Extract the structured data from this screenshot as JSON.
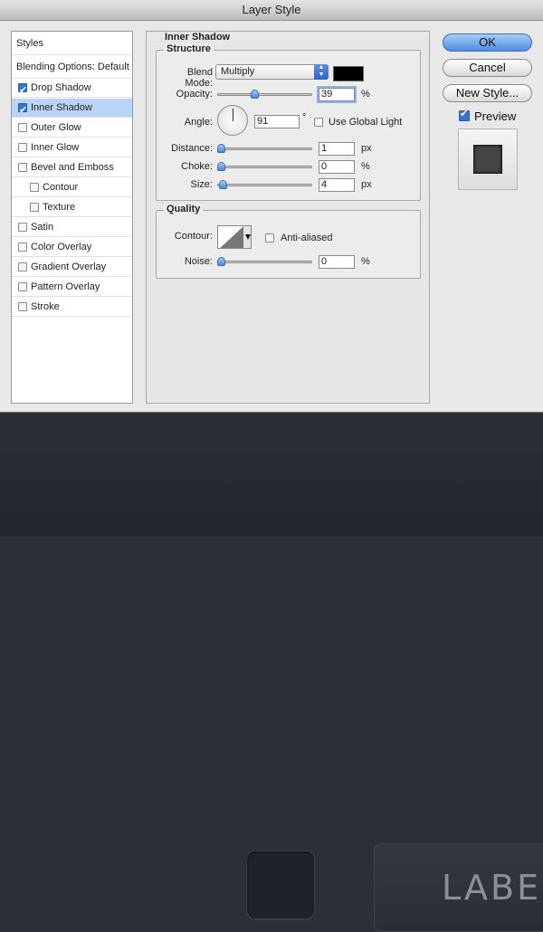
{
  "window": {
    "title": "Layer Style"
  },
  "styles_list": {
    "header": "Styles",
    "blending_options": "Blending Options: Default",
    "items": [
      {
        "label": "Drop Shadow",
        "checked": true,
        "selected": false,
        "indent": false
      },
      {
        "label": "Inner Shadow",
        "checked": true,
        "selected": true,
        "indent": false
      },
      {
        "label": "Outer Glow",
        "checked": false,
        "selected": false,
        "indent": false
      },
      {
        "label": "Inner Glow",
        "checked": false,
        "selected": false,
        "indent": false
      },
      {
        "label": "Bevel and Emboss",
        "checked": false,
        "selected": false,
        "indent": false
      },
      {
        "label": "Contour",
        "checked": false,
        "selected": false,
        "indent": true
      },
      {
        "label": "Texture",
        "checked": false,
        "selected": false,
        "indent": true
      },
      {
        "label": "Satin",
        "checked": false,
        "selected": false,
        "indent": false
      },
      {
        "label": "Color Overlay",
        "checked": false,
        "selected": false,
        "indent": false
      },
      {
        "label": "Gradient Overlay",
        "checked": false,
        "selected": false,
        "indent": false
      },
      {
        "label": "Pattern Overlay",
        "checked": false,
        "selected": false,
        "indent": false
      },
      {
        "label": "Stroke",
        "checked": false,
        "selected": false,
        "indent": false
      }
    ]
  },
  "panel": {
    "title": "Inner Shadow",
    "structure": {
      "title": "Structure",
      "blend_mode_label": "Blend Mode:",
      "blend_mode_value": "Multiply",
      "blend_color": "#000000",
      "opacity_label": "Opacity:",
      "opacity_value": "39",
      "opacity_unit": "%",
      "angle_label": "Angle:",
      "angle_value": "91",
      "angle_unit": "°",
      "global_light_label": "Use Global Light",
      "global_light_checked": false,
      "distance_label": "Distance:",
      "distance_value": "1",
      "distance_unit": "px",
      "choke_label": "Choke:",
      "choke_value": "0",
      "choke_unit": "%",
      "size_label": "Size:",
      "size_value": "4",
      "size_unit": "px"
    },
    "quality": {
      "title": "Quality",
      "contour_label": "Contour:",
      "anti_aliased_label": "Anti-aliased",
      "anti_aliased_checked": false,
      "noise_label": "Noise:",
      "noise_value": "0",
      "noise_unit": "%"
    }
  },
  "buttons": {
    "ok": "OK",
    "cancel": "Cancel",
    "new_style": "New Style...",
    "preview_label": "Preview",
    "preview_checked": true
  },
  "background": {
    "label_text": "LABEL"
  }
}
